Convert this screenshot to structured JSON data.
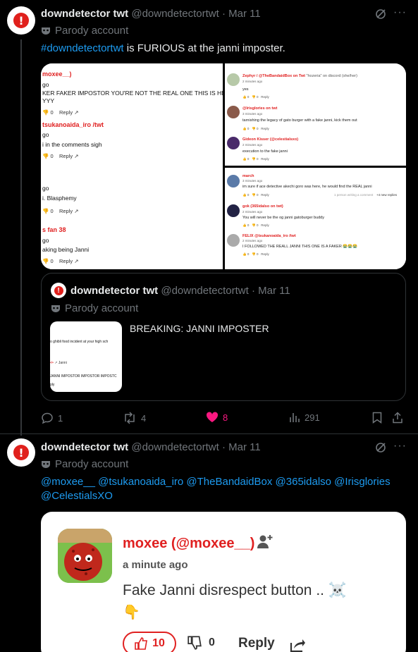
{
  "post1": {
    "display_name": "downdetector twt",
    "handle": "@downdetectortwt",
    "date": "Mar 11",
    "parody_label": "Parody account",
    "hashtag": "#downdetectortwt",
    "text_rest": " is FURIOUS at the janni imposter.",
    "media_left": {
      "comments": [
        {
          "name": "moxee__)",
          "time": "go",
          "text": "KER FAKER IMPOSTOR YOU'RE NOT THE REAL ONE THIS IS HERESY",
          "text2": "YYY",
          "likes": "0",
          "reply": "Reply"
        },
        {
          "name": "tsukanoaida_iro /twt",
          "time": "go",
          "text": "i in the comments sigh",
          "likes": "0",
          "reply": "Reply"
        },
        {
          "name": "",
          "time": "go",
          "text": "i. Blasphemy",
          "likes": "0",
          "reply": "Reply"
        },
        {
          "name": "s fan 38",
          "time": "go",
          "text": "aking being Janni",
          "likes": "0",
          "reply": "Reply"
        }
      ]
    },
    "media_right_top": [
      {
        "name": "Zephyr / @TheBandaidBox on Twt",
        "note": "\"hozeria\" on discord (she/her)",
        "time": "2 minutes ago",
        "text": "yes",
        "reply": "Reply"
      },
      {
        "name": "@Irisglories on twt",
        "time": "3 minutes ago",
        "text": "tarnishing the legacy of gato burger with a fake janni, kick them out",
        "reply": "Reply"
      },
      {
        "name": "Gideon Kisser (@celestialsxo)",
        "time": "2 minutes ago",
        "text": "execution to the fake janni",
        "reply": "Reply"
      }
    ],
    "media_right_bottom": [
      {
        "name": "march",
        "time": "3 minutes ago",
        "text": "im sure if ace detective akechi goro was here, he would find the REAL janni",
        "reply": "Reply",
        "typing": "1 person writing a comment",
        "new": "+4 new replies"
      },
      {
        "name": "gok (365idalso on twt)",
        "time": "2 minutes ago",
        "text": "You will never be the og janni gatoburger buddy",
        "reply": "Reply"
      },
      {
        "name": "FELIX @tsukanoaida_iro /twt",
        "time": "2 minutes ago",
        "text": "I FOLLOWED THE REALL JANNI THIS ONE IS A FAKER 😭😭😭",
        "reply": "Reply"
      }
    ],
    "quote": {
      "display_name": "downdetector twt",
      "handle": "@downdetectortwt",
      "date": "Mar 11",
      "parody_label": "Parody account",
      "text": "BREAKING: JANNI IMPOSTER",
      "thumb_line1": "o ghibli food incident at your high sch",
      "thumb_line2": "JANNI IMPOSTOR IMPOSTOR IMPOSTC",
      "thumb_reply": "ply",
      "thumb_janni": "Janni"
    },
    "actions": {
      "replies": "1",
      "reposts": "4",
      "likes": "8",
      "views": "291"
    }
  },
  "post2": {
    "display_name": "downdetector twt",
    "handle": "@downdetectortwt",
    "date": "Mar 11",
    "parody_label": "Parody account",
    "mentions_line1": "@moxee__ @tsukanoaida_iro @TheBandaidBox @365idalso @Irisglories",
    "mentions_line2": "@CelestialsXO",
    "card": {
      "name": "moxee (@moxee__)",
      "time": "a minute ago",
      "text": "Fake Janni disrespect button .. ☠️",
      "emoji": "👇",
      "likes": "10",
      "dislikes": "0",
      "reply": "Reply"
    }
  },
  "colors": {
    "accent": "#1d9bf0",
    "like_pink": "#f91880",
    "comment_name_red": "#e02020"
  }
}
